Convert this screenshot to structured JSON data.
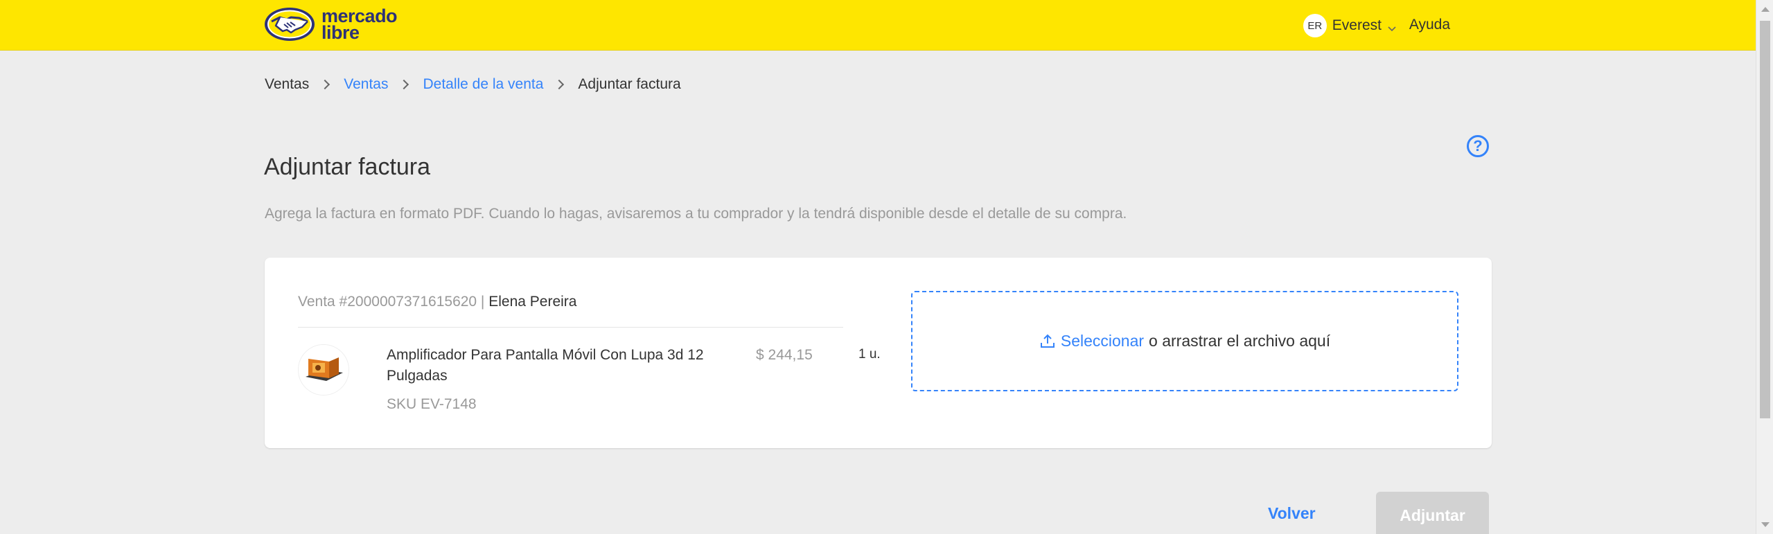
{
  "header": {
    "logo_text_line1": "mercado",
    "logo_text_line2": "libre",
    "user_initials": "ER",
    "user_name": "Everest",
    "help_label": "Ayuda",
    "brand_color": "#fee600"
  },
  "breadcrumb": {
    "items": [
      "Ventas",
      "Ventas",
      "Detalle de la venta",
      "Adjuntar factura"
    ]
  },
  "page": {
    "title": "Adjuntar factura",
    "subtitle": "Agrega la factura en formato PDF. Cuando lo hagas, avisaremos a tu comprador y la tendrá disponible desde el detalle de su compra.",
    "help_icon": "question-circle-icon"
  },
  "sale": {
    "number_label": "Venta #2000007371615620 | ",
    "buyer": "Elena Pereira",
    "product_title": "Amplificador Para Pantalla Móvil Con Lupa 3d 12 Pulgadas",
    "sku": "SKU EV-7148",
    "price": "$ 244,15",
    "quantity": "1 u."
  },
  "upload": {
    "select_label": "Seleccionar",
    "drop_label": "o arrastrar el archivo aquí",
    "accent_color": "#3483fa"
  },
  "actions": {
    "back_label": "Volver",
    "attach_label": "Adjuntar"
  }
}
